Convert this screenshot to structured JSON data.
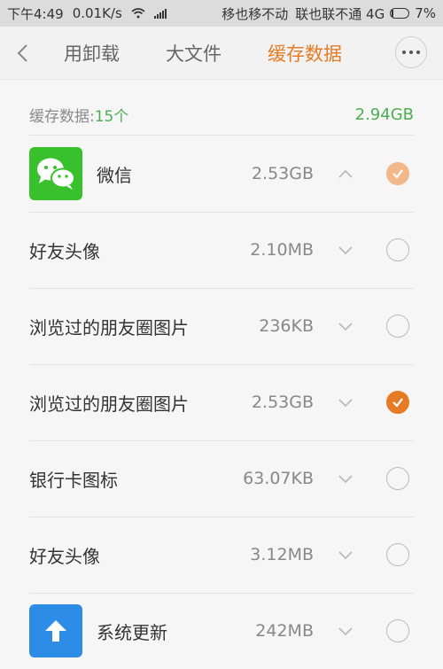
{
  "status_bar": {
    "time": "下午4:49",
    "speed": "0.01K/s",
    "carrier1": "移也移不动",
    "carrier2": "联也联不通 4G",
    "battery": "7%",
    "battery_level": 0.07
  },
  "tabbar": {
    "tabs": [
      {
        "label": "用卸载"
      },
      {
        "label": "大文件"
      },
      {
        "label": "缓存数据"
      }
    ],
    "active_tab": 2
  },
  "summary": {
    "label": "缓存数据:",
    "count": "15个",
    "total": "2.94GB"
  },
  "rows": [
    {
      "name": "微信",
      "size": "2.53GB",
      "expanded": true,
      "checked": "partial",
      "icon": "wechat-icon"
    },
    {
      "name": "好友头像",
      "size": "2.10MB",
      "expanded": false,
      "checked": "none"
    },
    {
      "name": "浏览过的朋友圈图片",
      "size": "236KB",
      "expanded": false,
      "checked": "none"
    },
    {
      "name": "浏览过的朋友圈图片",
      "size": "2.53GB",
      "expanded": false,
      "checked": "full"
    },
    {
      "name": "银行卡图标",
      "size": "63.07KB",
      "expanded": false,
      "checked": "none"
    },
    {
      "name": "好友头像",
      "size": "3.12MB",
      "expanded": false,
      "checked": "none"
    },
    {
      "name": "系统更新",
      "size": "242MB",
      "expanded": false,
      "checked": "none",
      "icon": "system-update-icon"
    }
  ],
  "colors": {
    "accent": "#e57c25",
    "accent_light": "#f3b88a",
    "green": "#4caf50",
    "wechat_green": "#39c12d",
    "update_blue": "#2d8ce6"
  }
}
